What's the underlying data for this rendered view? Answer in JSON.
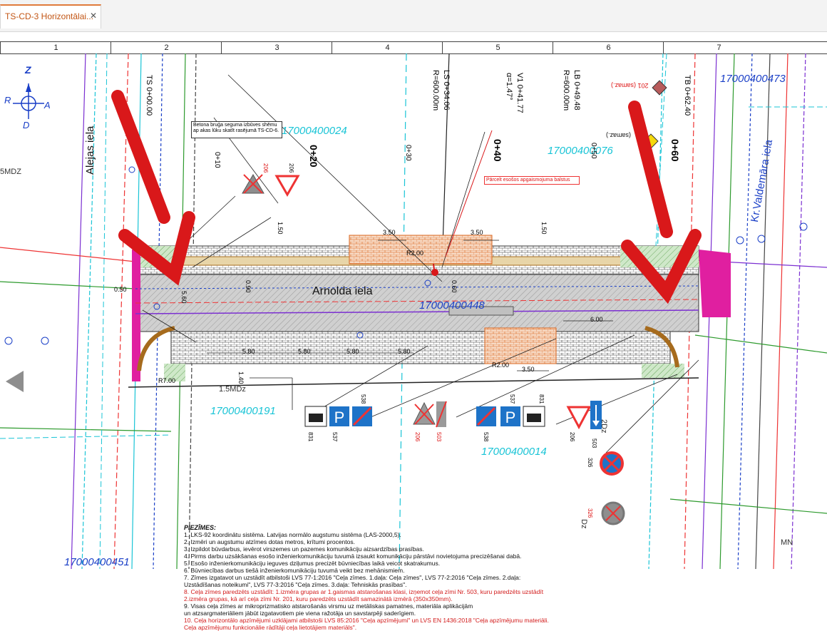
{
  "tab": {
    "title": "TS-CD-3 Horizontālai...",
    "close": "✕"
  },
  "ruler": [
    "1",
    "2",
    "3",
    "4",
    "5",
    "6",
    "7"
  ],
  "street": {
    "main": "Arnolda iela",
    "left": "Alejas iela",
    "right": "Kr.Valdemāra iela"
  },
  "compass": {
    "n": "Z",
    "w": "R",
    "e": "A",
    "s": "D"
  },
  "parcels": [
    "17000400024",
    "17000400076",
    "17000400473",
    "17000400448",
    "17000400191",
    "17000400014",
    "17000400451"
  ],
  "stations": [
    "0+10",
    "0+20",
    "0+30",
    "0+40",
    "0+50",
    "0+60"
  ],
  "curve_labels": [
    "LS 0+34.06",
    "R=600.00m",
    "V1 0+41.77",
    "α=1.47°",
    "LB 0+49.48",
    "R=600.00m",
    "TS 0+00.00",
    "TB 0+62.40"
  ],
  "dims": [
    "3.50",
    "3.50",
    "5.80",
    "5.80",
    "5.80",
    "5.80",
    "6.00",
    "3.50",
    "1.50",
    "1.50",
    "5.60",
    "0.90",
    "0.60",
    "R2.00",
    "R2.00",
    "R7.00",
    "1.40",
    "0.50"
  ],
  "zones": [
    "5MDZ",
    "1.5MDz",
    "2Dz",
    "Dz",
    "MN"
  ],
  "note_box": "Betona bruģa seguma izbūves shēmu ap akas lūku skatīt rasējumā TS-CD-6.",
  "red_note": "Pārcelt esošos apgaismojuma balstus",
  "signs": {
    "s206a": "206",
    "s206b": "206",
    "s538a": "538",
    "s537a": "537",
    "s831a": "831",
    "s503": "503",
    "s538b": "538",
    "s537b": "537",
    "s831b": "831",
    "s206c": "206",
    "s503b": "503",
    "s326a": "326",
    "s326b": "326",
    "s201": "201 (samaz.)",
    "samaz": "(samaz.)"
  },
  "notes": {
    "title": "PIEZĪMES:",
    "items": [
      "1.  LKS-92 koordinātu sistēma. Latvijas normālo augstumu sistēma (LAS-2000,5).",
      "2.  Izmēri un augstumu atzīmes dotas metros, krītumi procentos.",
      "3.  Izpildot būvdarbus, ievērot virszemes un pazemes komunikāciju aizsardzības prasības.",
      "4.  Pirms darbu uzsākšanas esošo inženierkomunikāciju tuvumā izsaukt komunikāciju pārstāvi novietojuma precizēšanai dabā.",
      "5.  Esošo inženierkomunikāciju ieguves dziļumus precizēt būvniecības laikā veicot skatrakumus.",
      "6.  Būvniecības darbus tiešā inženierkomunikāciju tuvumā veikt bez mehānismiem.",
      "7.  Zīmes izgatavot un uzstādīt atbilstoši LVS 77-1:2016 \"Ceļa zīmes. 1.daļa: Ceļa zīmes\", LVS 77-2:2016 \"Ceļa zīmes. 2.daļa:",
      "     Uzstādīšanas noteikumi\", LVS 77-3:2016 \"Ceļa zīmes. 3.daļa: Tehniskās prasības\".",
      "8.  Ceļa zīmes paredzēts uzstādīt: 1.izmēra grupas ar 1.gaismas atstarošanas klasi, izņemot ceļa zīmi Nr. 503, kuru paredzēts uzstādīt",
      "     2.izmēra grupas, kā arī ceļa zīmi Nr. 201, kuru paredzēts uzstādīt samazinātā izmērā (350x350mm).",
      "9.  Visas ceļa zīmes ar mikroprizmatisko atstarošanās virsmu uz metāliskas pamatnes, materiāla aplikācijām",
      "     un atzsargmateriāliem jābūt izgatavotiem pie viena ražotāja un savstarpēji saderīgiem.",
      "10. Ceļa horizontālo apzīmējumi uzklājami atbilstoši LVS 85:2016 \"Ceļa apzīmējumi\" un LVS EN 1436:2018 \"Ceļa apzīmējumu materiāli.",
      "      Ceļa apzīmējumu funkcionālie rādītāji ceļa lietotājiem materiāls\"."
    ]
  },
  "colors": {
    "tab_accent": "#e07a3a",
    "arrow": "#d9181a",
    "parcel": "#19c4d6",
    "parcel_alt": "#1a3fc7",
    "road": "#c9c9c9"
  }
}
